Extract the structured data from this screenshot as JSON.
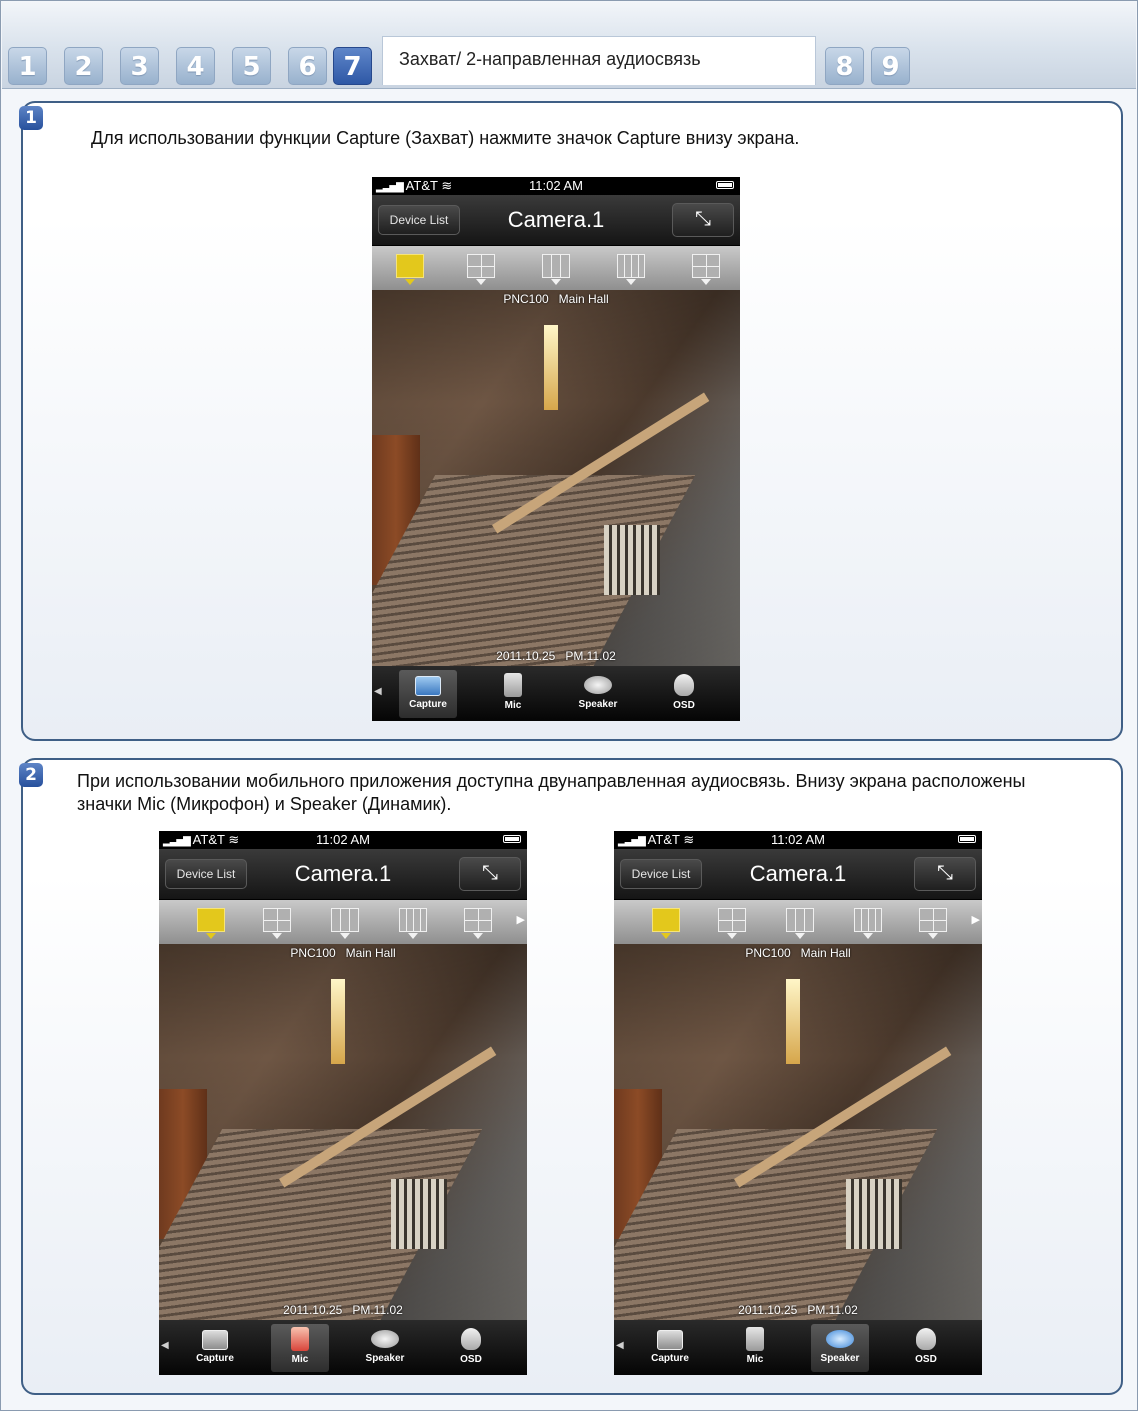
{
  "tabs": [
    {
      "label": "1",
      "active": false
    },
    {
      "label": "2",
      "active": false
    },
    {
      "label": "3",
      "active": false
    },
    {
      "label": "4",
      "active": false
    },
    {
      "label": "5",
      "active": false
    },
    {
      "label": "6",
      "active": false
    },
    {
      "label": "7",
      "active": true
    },
    {
      "label": "8",
      "active": false
    },
    {
      "label": "9",
      "active": false
    }
  ],
  "active_tab_title": "Захват/ 2-направленная аудиосвязь",
  "steps": [
    {
      "number": "1",
      "text": "Для использовании функции Capture (Захват) нажмите значок Capture внизу экрана."
    },
    {
      "number": "2",
      "text": "При использовании мобильного приложения доступна двунаправленная аудиосвязь. Внизу экрана расположены значки Mic (Микрофон) и Speaker (Динамик)."
    }
  ],
  "phone": {
    "carrier": "AT&T",
    "time": "11:02 AM",
    "device_list_button": "Device List",
    "camera_title": "Camera.1",
    "video_model": "PNC100",
    "video_location": "Main Hall",
    "video_date": "2011.10.25",
    "video_time": "PM.11.02",
    "toolbar": {
      "capture": "Capture",
      "mic": "Mic",
      "speaker": "Speaker",
      "osd": "OSD"
    }
  },
  "colors": {
    "accent": "#2e58a6",
    "panel_border": "#3f5f86",
    "layout_selected": "#e3c81c"
  }
}
